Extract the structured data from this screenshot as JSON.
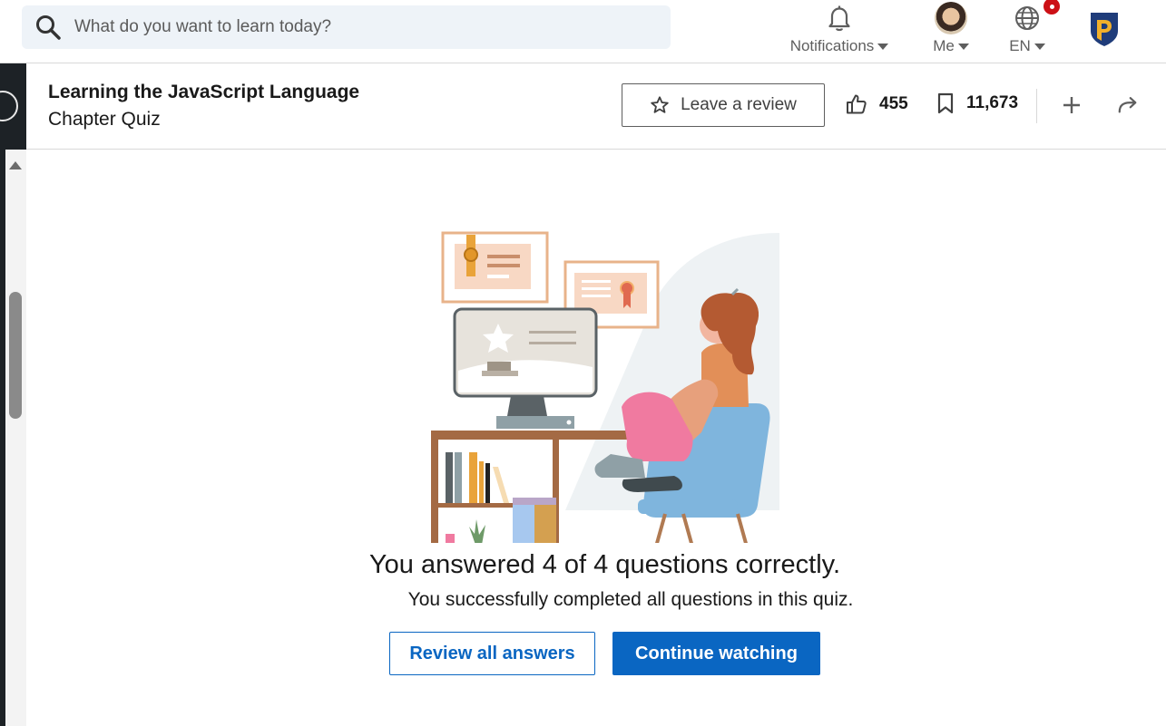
{
  "search": {
    "placeholder": "What do you want to learn today?",
    "icon": "search-icon"
  },
  "nav": {
    "notifications_label": "Notifications",
    "me_label": "Me",
    "lang_label": "EN"
  },
  "course": {
    "title": "Learning the JavaScript Language",
    "subtitle": "Chapter Quiz",
    "review_label": "Leave a review",
    "likes": "455",
    "saves": "11,673"
  },
  "result": {
    "title": "You answered 4 of 4 questions correctly.",
    "subtitle": "You successfully completed all questions in this quiz.",
    "review_button": "Review all answers",
    "continue_button": "Continue watching"
  },
  "colors": {
    "accent": "#0a66c2",
    "badge": "#cc1016",
    "search_bg": "#eef3f8"
  }
}
